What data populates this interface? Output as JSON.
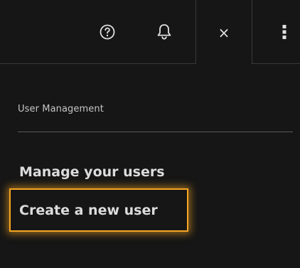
{
  "header": {
    "help_icon": "help-circle-icon",
    "notification_icon": "bell-icon",
    "close_label": "×",
    "more_icon": "overflow-menu-vertical-icon"
  },
  "panel": {
    "section_title": "User Management",
    "links": [
      {
        "label": "Manage your users"
      },
      {
        "label": "Create a new user",
        "highlighted": true
      }
    ]
  },
  "colors": {
    "background": "#161616",
    "text": "#dcdcdc",
    "highlight": "#f5a623"
  }
}
